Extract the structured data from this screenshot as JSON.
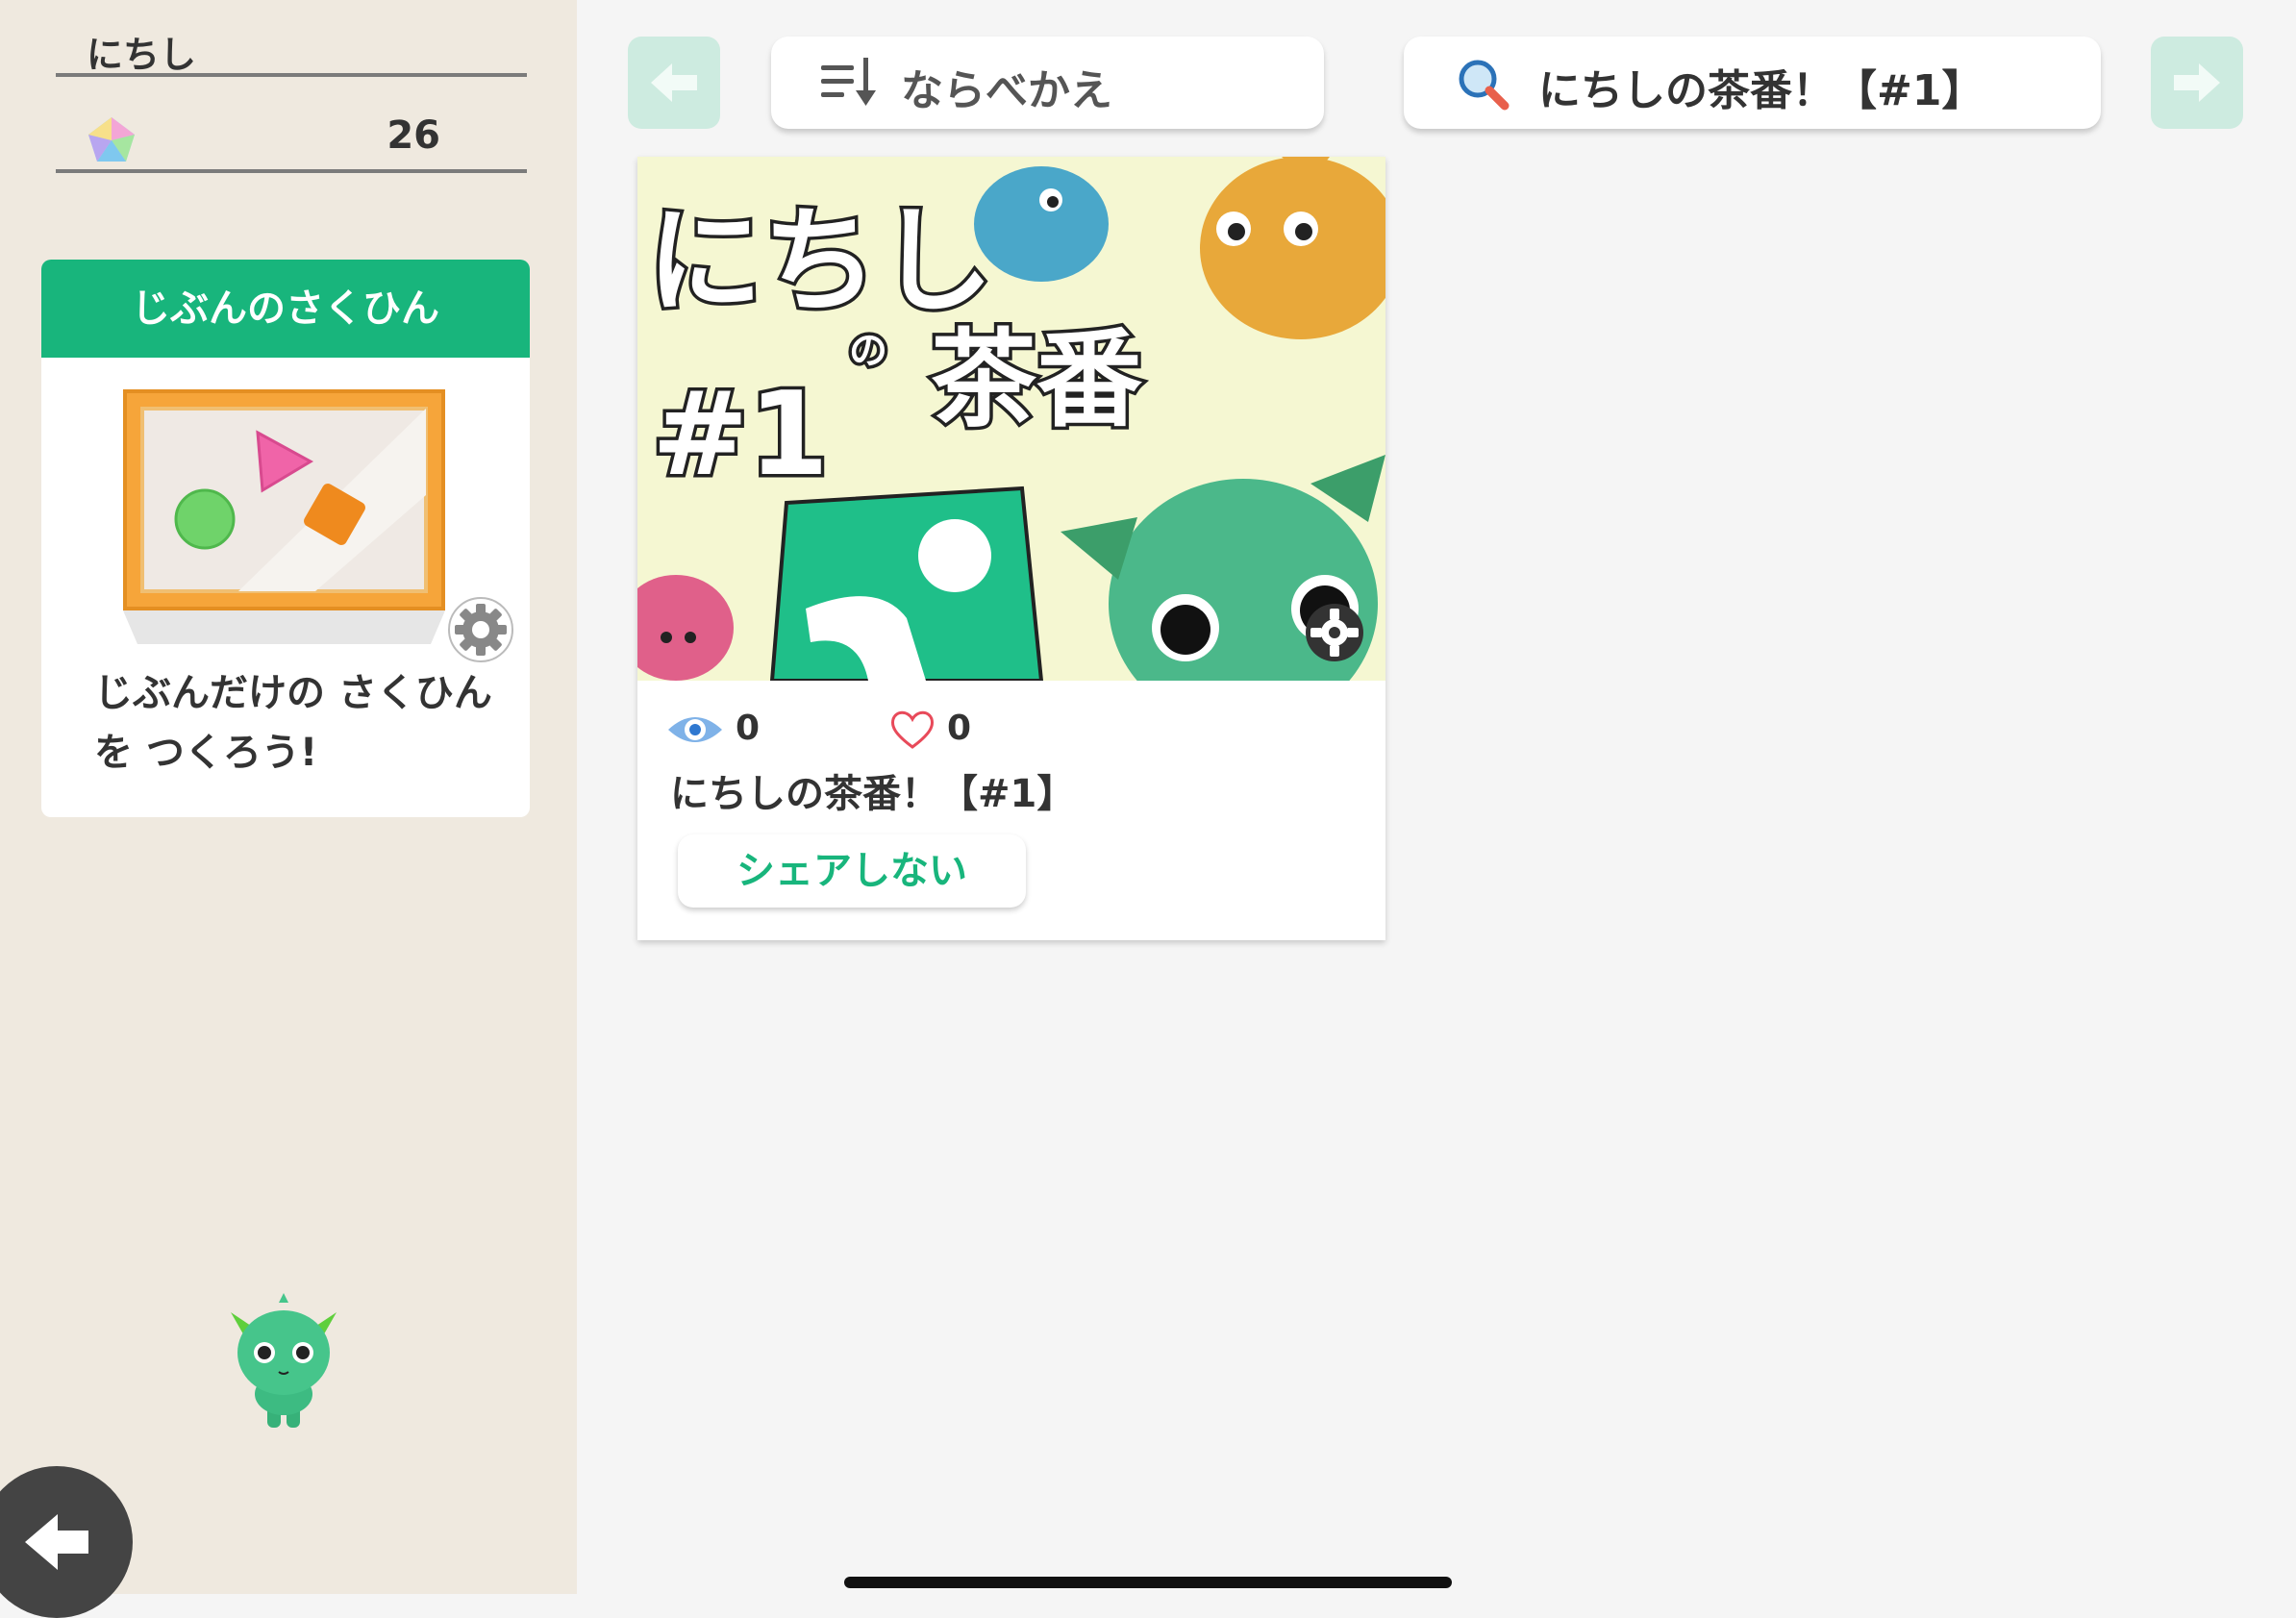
{
  "user": {
    "name": "にちし",
    "points": "26"
  },
  "my_works": {
    "header": "じぶんのさくひん",
    "description": "じぶんだけの さくひんを つくろう!"
  },
  "toolbar": {
    "sort_label": "ならべかえ",
    "search_value": "にちしの茶番！【#1】"
  },
  "works": [
    {
      "thumbnail_text": {
        "title": "にちし",
        "no": "の",
        "sub": "茶番",
        "num": "#1"
      },
      "views": "0",
      "likes": "0",
      "title": "にちしの茶番！【#1】",
      "share_label": "シェアしない"
    }
  ],
  "colors": {
    "accent_green": "#18b57c",
    "sidebar_bg": "#efe9df",
    "main_bg": "#f5f5f5",
    "nav_disabled": "#cdebe0"
  },
  "icons": [
    "gem-icon",
    "gear-icon",
    "sort-icon",
    "search-icon",
    "eye-icon",
    "heart-icon",
    "arrow-left-icon",
    "arrow-right-icon",
    "back-arrow-icon"
  ]
}
